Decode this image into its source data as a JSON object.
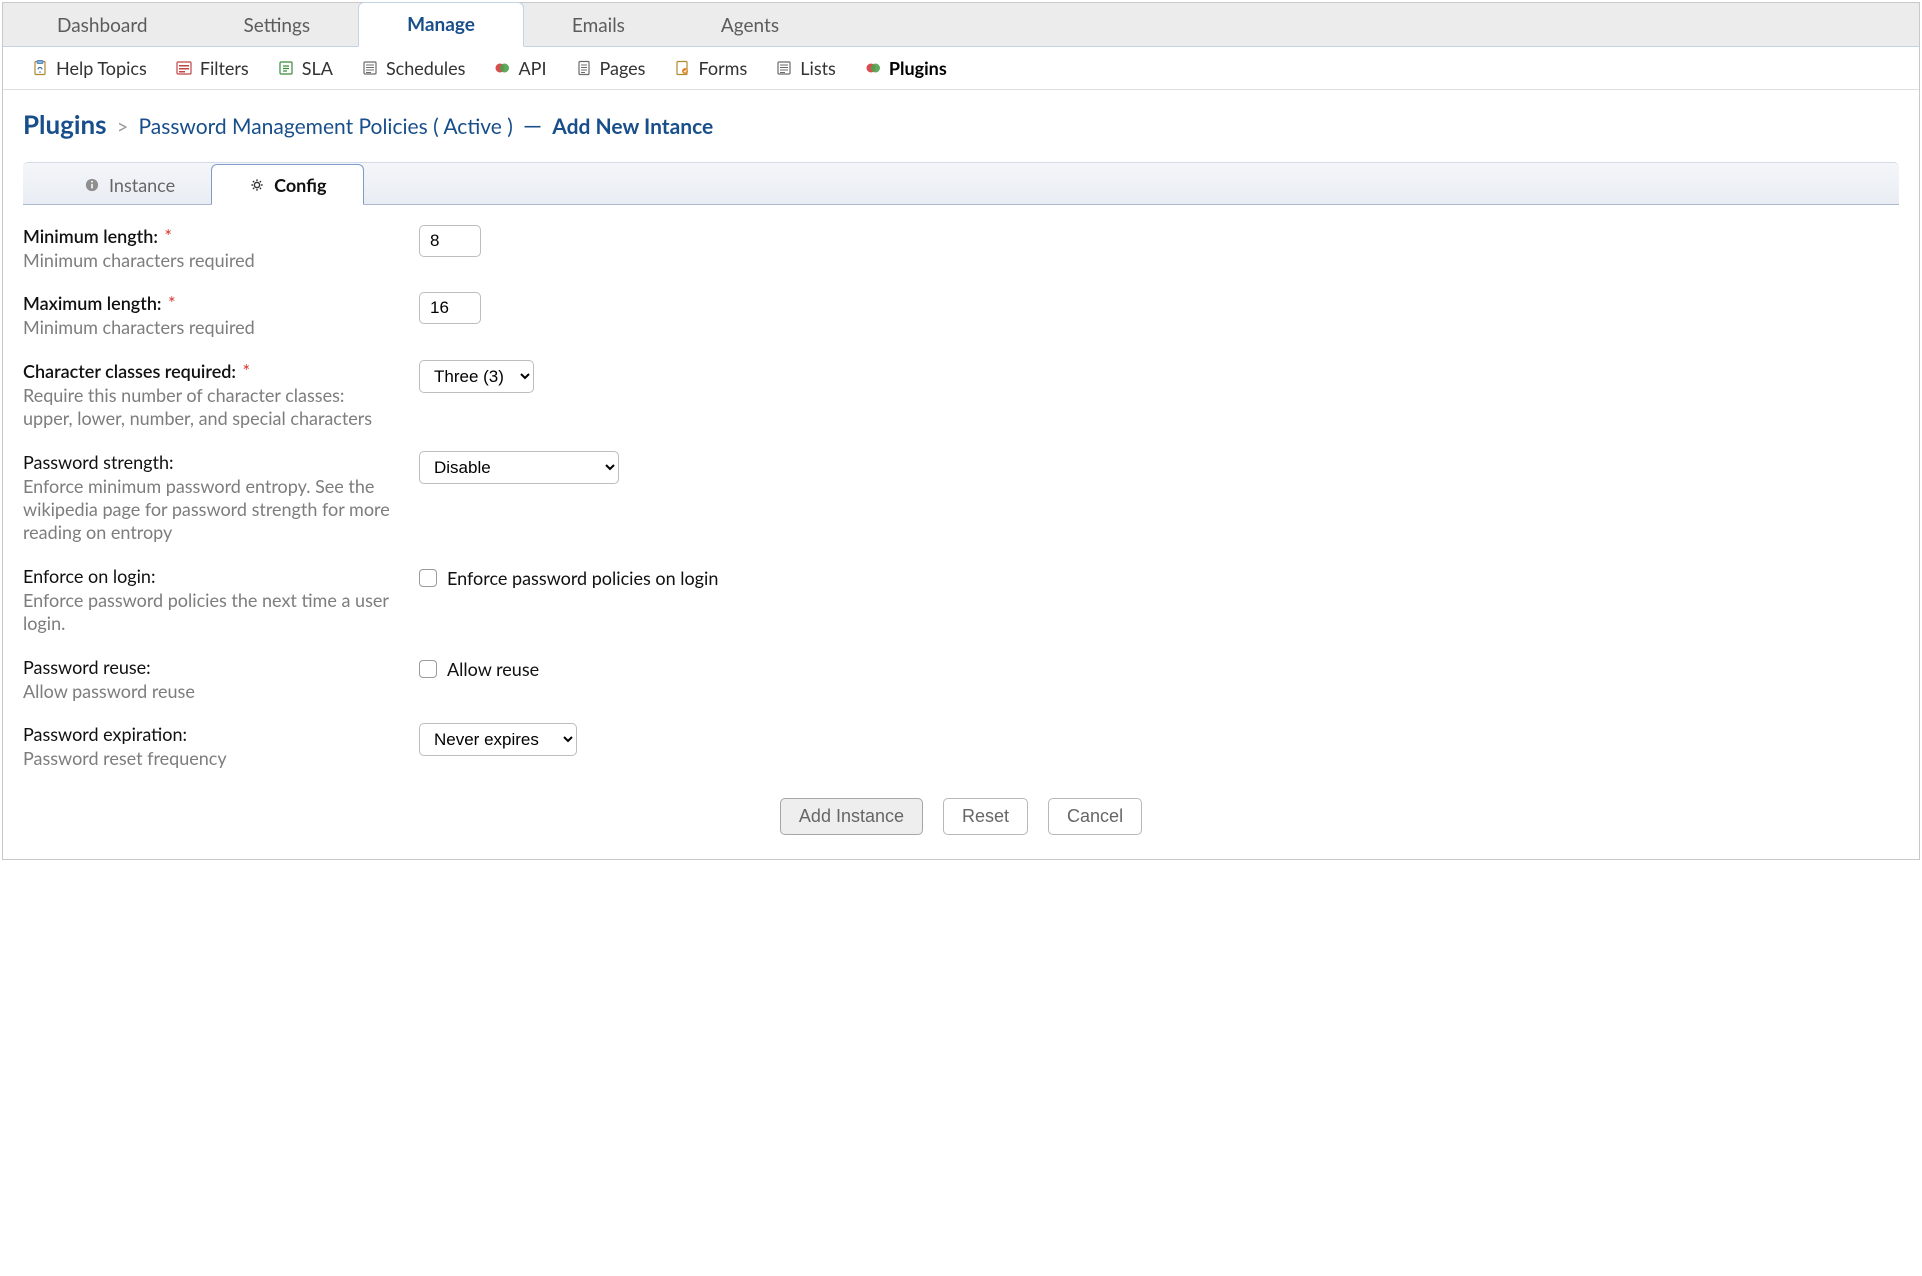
{
  "primary_tabs": {
    "dashboard": "Dashboard",
    "settings": "Settings",
    "manage": "Manage",
    "emails": "Emails",
    "agents": "Agents"
  },
  "subnav": {
    "help_topics": "Help Topics",
    "filters": "Filters",
    "sla": "SLA",
    "schedules": "Schedules",
    "api": "API",
    "pages": "Pages",
    "forms": "Forms",
    "lists": "Lists",
    "plugins": "Plugins"
  },
  "breadcrumb": {
    "root": "Plugins",
    "sep": ">",
    "mid": "Password Management Policies ( Active )",
    "dash": "—",
    "tail": "Add New Intance"
  },
  "inner_tabs": {
    "instance": "Instance",
    "config": "Config"
  },
  "form": {
    "min_length": {
      "label": "Minimum length:",
      "required": "*",
      "help": "Minimum characters required",
      "value": "8"
    },
    "max_length": {
      "label": "Maximum length:",
      "required": "*",
      "help": "Minimum characters required",
      "value": "16"
    },
    "char_classes": {
      "label": "Character classes required:",
      "required": "*",
      "help": "Require this number of character classes: upper, lower, number, and special characters",
      "value": "Three (3)"
    },
    "strength": {
      "label": "Password strength:",
      "help": "Enforce minimum password entropy. See the wikipedia page for password strength for more reading on entropy",
      "value": "Disable"
    },
    "enforce_login": {
      "label": "Enforce on login:",
      "help": "Enforce password policies the next time a user login.",
      "checkbox_label": "Enforce password policies on login"
    },
    "reuse": {
      "label": "Password reuse:",
      "help": "Allow password reuse",
      "checkbox_label": "Allow reuse"
    },
    "expiration": {
      "label": "Password expiration:",
      "help": "Password reset frequency",
      "value": "Never expires"
    }
  },
  "buttons": {
    "add": "Add Instance",
    "reset": "Reset",
    "cancel": "Cancel"
  }
}
